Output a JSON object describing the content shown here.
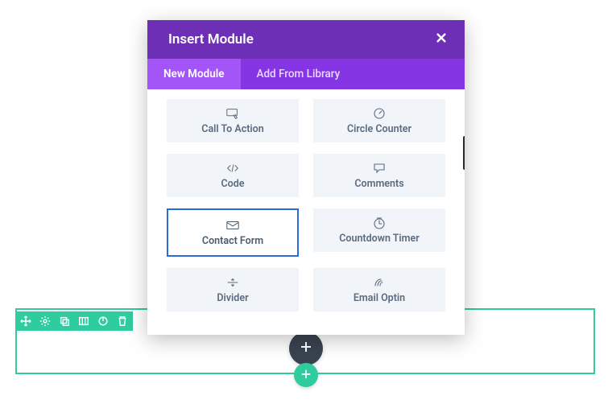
{
  "modal": {
    "title": "Insert Module",
    "tabs": [
      "New Module",
      "Add From Library"
    ],
    "active_tab": 0,
    "modules": [
      {
        "label": "Call To Action",
        "icon": "call-to-action",
        "selected": false
      },
      {
        "label": "Circle Counter",
        "icon": "circle-counter",
        "selected": false
      },
      {
        "label": "Code",
        "icon": "code",
        "selected": false
      },
      {
        "label": "Comments",
        "icon": "comments",
        "selected": false
      },
      {
        "label": "Contact Form",
        "icon": "contact-form",
        "selected": true
      },
      {
        "label": "Countdown Timer",
        "icon": "countdown",
        "selected": false
      },
      {
        "label": "Divider",
        "icon": "divider",
        "selected": false
      },
      {
        "label": "Email Optin",
        "icon": "email-optin",
        "selected": false
      }
    ]
  },
  "colors": {
    "purple_dark": "#6c2fb5",
    "purple": "#8535e4",
    "purple_light": "#a455f7",
    "teal": "#2ecc9e",
    "blue_select": "#2a6bd6",
    "gray_bg": "#f1f5f9",
    "gray_text": "#5b6b7f"
  }
}
